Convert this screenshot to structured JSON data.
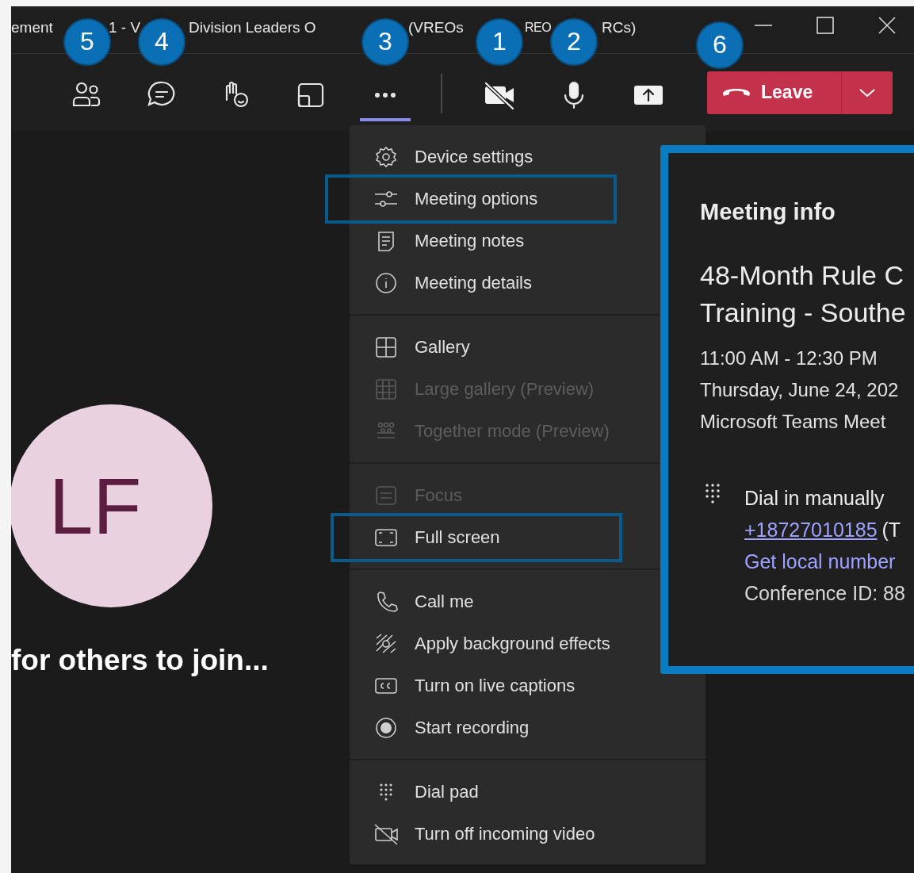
{
  "window": {
    "title_fragments": [
      "ement",
      "1 - V",
      "Division Leaders O",
      "(VREOs",
      "REO",
      "RCs)"
    ],
    "controls": [
      {
        "kind": "minimize"
      },
      {
        "kind": "maximize"
      },
      {
        "kind": "close"
      }
    ]
  },
  "toolbar": {
    "buttons": [
      {
        "kind": "people",
        "selected": false,
        "callout": "5"
      },
      {
        "kind": "chat",
        "selected": false,
        "callout": "4"
      },
      {
        "kind": "reactions",
        "selected": false
      },
      {
        "kind": "rooms",
        "selected": false
      },
      {
        "kind": "more",
        "selected": true,
        "callout": "3"
      },
      {
        "kind": "camera-off",
        "selected": false,
        "callout": "1"
      },
      {
        "kind": "mic",
        "selected": false,
        "callout": "2"
      },
      {
        "kind": "share",
        "selected": false
      }
    ],
    "leave_button": {
      "label": "Leave",
      "callout": "6"
    }
  },
  "menu": {
    "groups": [
      [
        {
          "kind": "gear",
          "label": "Device settings",
          "disabled": false,
          "highlighted": false
        },
        {
          "kind": "sliders",
          "label": "Meeting options",
          "disabled": false,
          "highlighted": true
        },
        {
          "kind": "notes",
          "label": "Meeting notes",
          "disabled": false,
          "highlighted": false
        },
        {
          "kind": "info",
          "label": "Meeting details",
          "disabled": false,
          "highlighted": false
        }
      ],
      [
        {
          "kind": "gallery",
          "label": "Gallery",
          "disabled": false,
          "highlighted": false
        },
        {
          "kind": "large-gallery",
          "label": "Large gallery (Preview)",
          "disabled": true,
          "highlighted": false
        },
        {
          "kind": "together",
          "label": "Together mode (Preview)",
          "disabled": true,
          "highlighted": false
        }
      ],
      [
        {
          "kind": "focus",
          "label": "Focus",
          "disabled": true,
          "highlighted": false
        },
        {
          "kind": "fullscreen",
          "label": "Full screen",
          "disabled": false,
          "highlighted": true
        }
      ],
      [
        {
          "kind": "phone",
          "label": "Call me",
          "disabled": false,
          "highlighted": false
        },
        {
          "kind": "background",
          "label": "Apply background effects",
          "disabled": false,
          "highlighted": false
        },
        {
          "kind": "captions",
          "label": "Turn on live captions",
          "disabled": false,
          "highlighted": false
        },
        {
          "kind": "record",
          "label": "Start recording",
          "disabled": false,
          "highlighted": false
        }
      ],
      [
        {
          "kind": "dialpad",
          "label": "Dial pad",
          "disabled": false,
          "highlighted": false
        },
        {
          "kind": "video-off",
          "label": "Turn off incoming video",
          "disabled": false,
          "highlighted": false
        }
      ]
    ]
  },
  "meeting_info": {
    "title": "Meeting info",
    "meeting_title_lines": [
      "48-Month Rule C",
      "Training - Southe"
    ],
    "details": [
      "11:00 AM - 12:30 PM",
      "Thursday, June 24, 202",
      "Microsoft Teams Meet"
    ],
    "dial_in": {
      "heading": "Dial in manually",
      "phone": "+18727010185",
      "phone_suffix": "(T",
      "local_numbers_link": "Get local number",
      "conference_id": "Conference ID: 88"
    }
  },
  "stage": {
    "avatar_initials": "LF",
    "status": "for others to join..."
  }
}
